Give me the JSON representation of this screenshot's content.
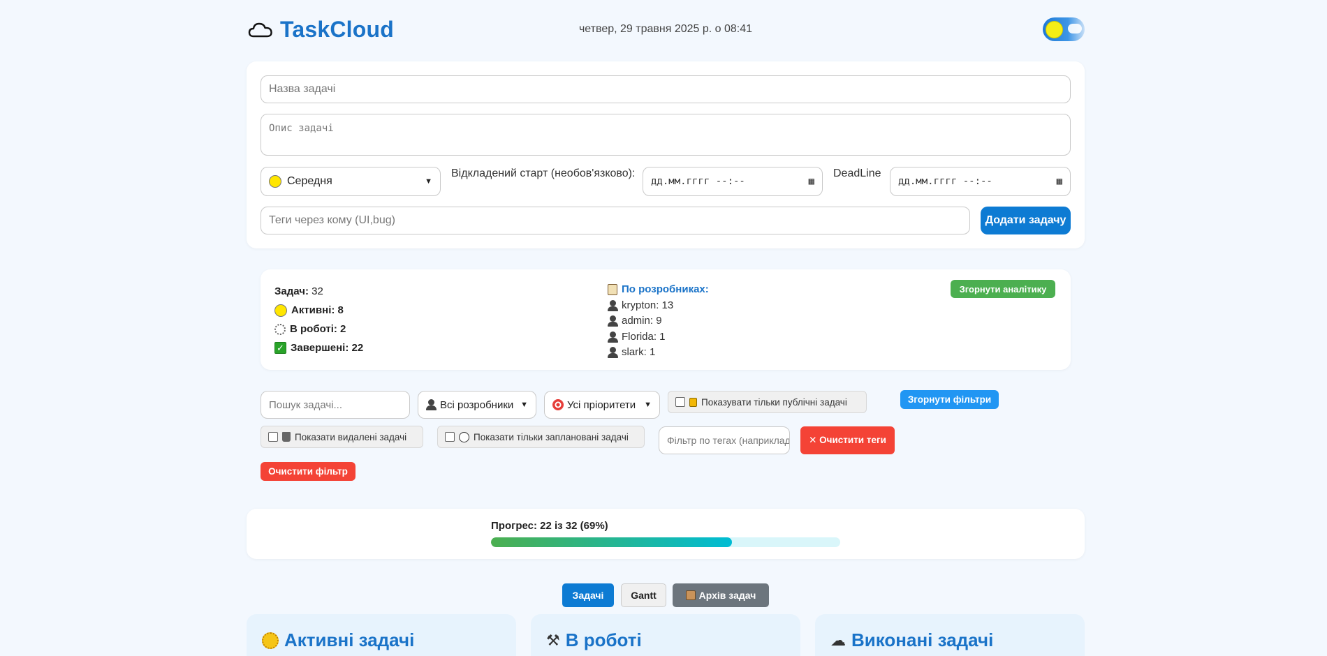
{
  "app": {
    "title": "TaskCloud",
    "datetime": "четвер, 29 травня 2025 р. о 08:41"
  },
  "form": {
    "title_placeholder": "Назва задачі",
    "description_placeholder": "Опис задачі",
    "priority_value": "Середня",
    "delayed_start_label": "Відкладений старт (необов'язково):",
    "datetime_placeholder": "дд.мм.гггг --:--",
    "deadline_label": "DeadLine",
    "tags_placeholder": "Теги через кому (UI,bug)",
    "add_button": "Додати задачу"
  },
  "stats": {
    "total_label": "Задач:",
    "total_value": "32",
    "active": "Активні: 8",
    "in_progress": "В роботі: 2",
    "done": "Завершені: 22",
    "by_dev_title": "По розробниках:",
    "developers": [
      "krypton: 13",
      "admin: 9",
      "Florida: 1",
      "slark: 1"
    ],
    "collapse_button": "Згорнути аналітику"
  },
  "filters": {
    "search_placeholder": "Пошук задачі...",
    "dev_select": "Всі розробники",
    "priority_select": "Усі пріоритети",
    "public_only": "Показувати тільки публічні задачі",
    "collapse_button": "Згорнути фільтри",
    "show_deleted": "Показати видалені задачі",
    "show_planned": "Показати тільки заплановані задачі",
    "tag_filter_placeholder": "Фільтр по тегах (наприклад",
    "clear_tags": "✕ Очистити теги",
    "clear_filter": "Очистити фільтр"
  },
  "progress": {
    "label": "Прогрес: 22 із 32 (69%)",
    "fraction": 0.69
  },
  "tabs": {
    "tasks": "Задачі",
    "gantt": "Gantt",
    "archive": "Архів задач"
  },
  "columns": [
    "Активні задачі",
    "В роботі",
    "Виконані задачі"
  ],
  "colors": {
    "accent": "#0d7bd3",
    "green": "#4caf50",
    "red": "#f44336",
    "sky": "#2196f3"
  }
}
